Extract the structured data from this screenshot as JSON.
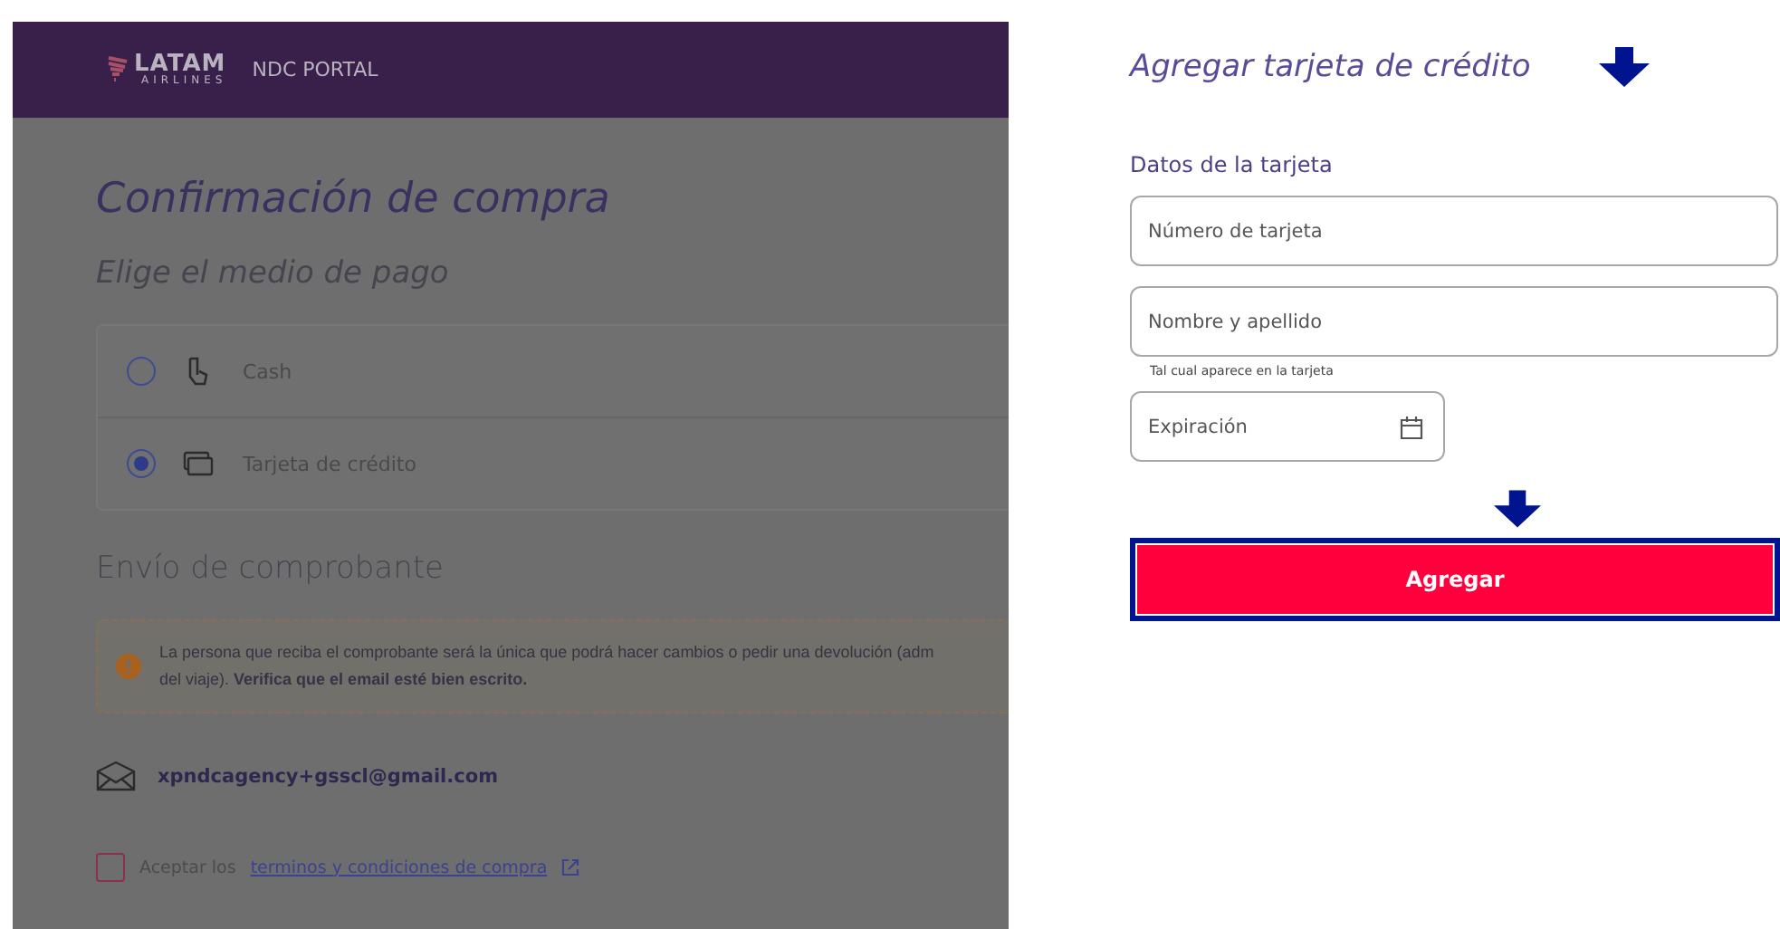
{
  "header": {
    "logo_word": "LATAM",
    "logo_sub": "AIRLINES",
    "portal": "NDC PORTAL"
  },
  "purchase": {
    "title": "Confirmación de compra",
    "subtitle": "Elige el medio de pago",
    "payment_options": [
      {
        "kind": "cash",
        "label": "Cash",
        "selected": false
      },
      {
        "kind": "card",
        "label": "Tarjeta de crédito",
        "selected": true
      }
    ],
    "receipt_title": "Envío de comprobante",
    "notice_lines": [
      "La persona que reciba el comprobante será la única que podrá hacer cambios o pedir una devolución (adm",
      "del viaje). **Verifica que el email esté bien escrito.**"
    ],
    "email": "xpndcagency+gsscl@gmail.com",
    "terms": {
      "checked": false,
      "prefix": "Aceptar los",
      "link": "terminos y condiciones de compra"
    }
  },
  "card_form": {
    "title": "Agregar tarjeta de crédito",
    "section": "Datos de la tarjeta",
    "fields": [
      {
        "kind": "text",
        "placeholder": "Número de tarjeta"
      },
      {
        "kind": "text",
        "placeholder": "Nombre y apellido",
        "hint": "Tal cual aparece en la tarjeta"
      },
      {
        "kind": "date",
        "placeholder": "Expiración"
      }
    ],
    "submit": "Agregar"
  }
}
